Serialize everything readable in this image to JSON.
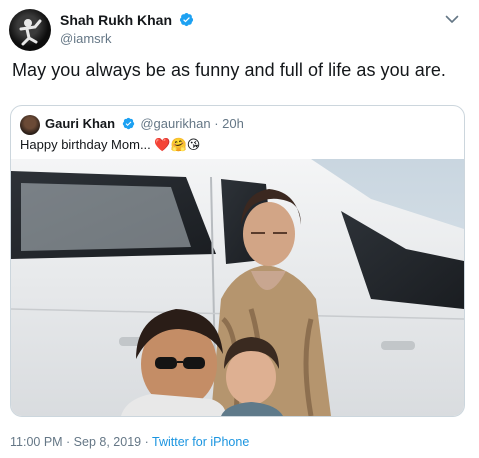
{
  "tweet": {
    "author_name": "Shah Rukh Khan",
    "author_handle": "@iamsrk",
    "text": "May you always be as funny and full of life as you are.",
    "timestamp": "11:00 PM · Sep 8, 2019 · ",
    "source": "Twitter for iPhone"
  },
  "quoted": {
    "author_name": "Gauri Khan",
    "author_handle": "@gaurikhan · 20h",
    "text": "Happy birthday Mom... ❤️🤗😘"
  },
  "colors": {
    "verified": "#1da1f2",
    "link": "#1b95e0",
    "muted": "#657786",
    "border": "#ccd6dd"
  },
  "icons": [
    "verified-badge-icon",
    "chevron-down-icon"
  ]
}
